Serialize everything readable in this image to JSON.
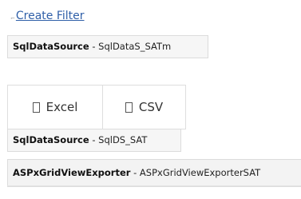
{
  "filter": {
    "link_label": "Create Filter",
    "icon": "filter-icon"
  },
  "datasources": [
    {
      "type": "SqlDataSource",
      "sep": " - ",
      "id": "SqlDataS_SATm"
    },
    {
      "type": "SqlDataSource",
      "sep": " - ",
      "id": "SqlDS_SAT"
    },
    {
      "type": "ASPxGridViewExporter",
      "sep": " - ",
      "id": "ASPxGridViewExporterSAT"
    }
  ],
  "export": {
    "excel_label": "Excel",
    "csv_label": "CSV",
    "icon": "placeholder-glyph-icon"
  },
  "colors": {
    "link": "#2f5fa8",
    "box_bg": "#f6f6f6",
    "border": "#dcdcdc"
  }
}
